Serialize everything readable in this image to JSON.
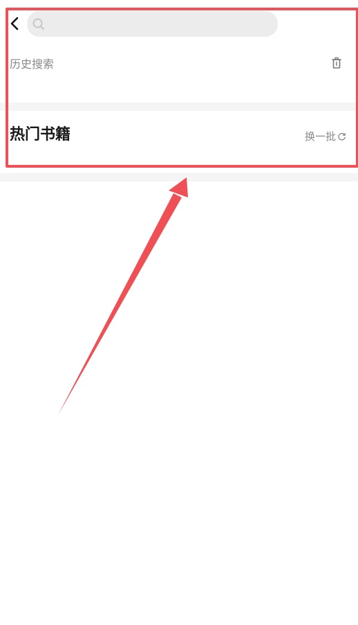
{
  "header": {
    "back_icon": "chevron-left-icon",
    "search": {
      "icon": "search-icon",
      "value": "",
      "placeholder": ""
    }
  },
  "history": {
    "title": "历史搜索",
    "clear_icon": "trash-icon"
  },
  "hot_books": {
    "title": "热门书籍",
    "refresh_label": "换一批",
    "refresh_icon": "refresh-icon"
  },
  "annotation": {
    "color": "#ee5055"
  }
}
